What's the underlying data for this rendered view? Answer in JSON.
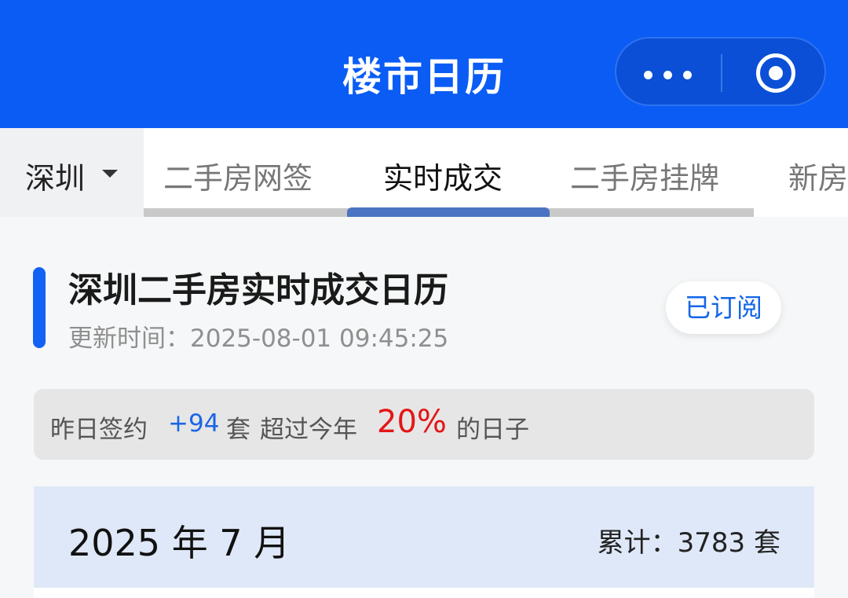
{
  "header": {
    "title": "楼市日历",
    "more_icon": "more-dots-icon",
    "capsule_close_icon": "target-circle-icon",
    "color": "#0a5cf5"
  },
  "tabs": {
    "city": "深圳",
    "items": [
      {
        "label": "二手房网签",
        "active": false
      },
      {
        "label": "实时成交",
        "active": true
      },
      {
        "label": "二手房挂牌",
        "active": false
      },
      {
        "label": "新房",
        "active": false
      }
    ],
    "active_indicator_color": "#4a74c3"
  },
  "page": {
    "title": "深圳二手房实时成交日历",
    "update_label": "更新时间：",
    "update_time": "2025-08-01 09:45:25",
    "subscribe_label": "已订阅"
  },
  "info": {
    "prefix": "昨日签约",
    "count": "+94",
    "unit": "套",
    "middle": "超过今年",
    "percent": "20%",
    "suffix": "的日子"
  },
  "month": {
    "title": "2025 年 7 月",
    "total_label": "累计：3783 套"
  }
}
